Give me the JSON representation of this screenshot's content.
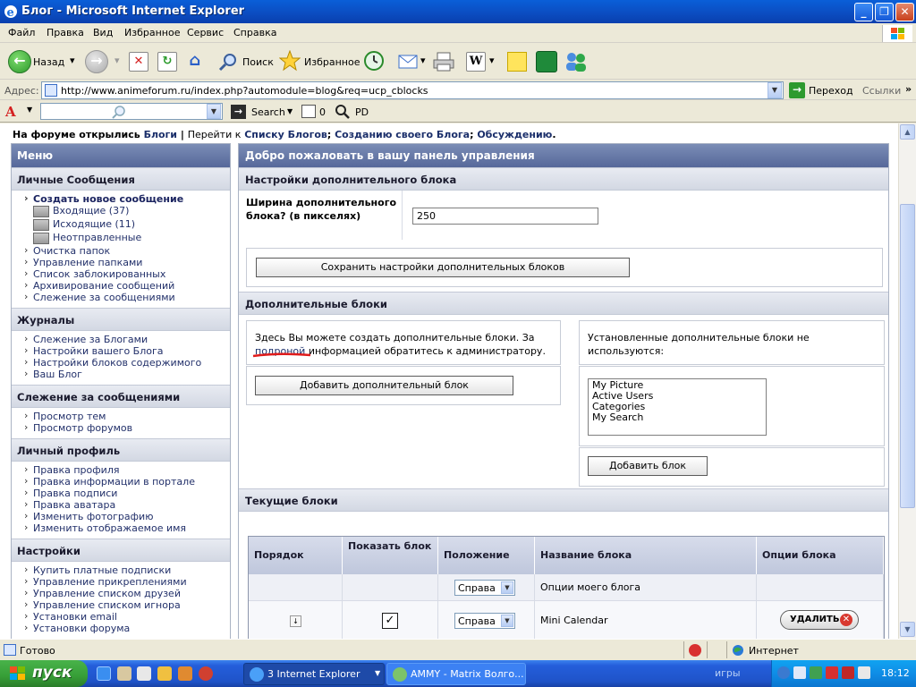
{
  "window": {
    "title": "Блог - Microsoft Internet Explorer",
    "min_glyph": "_",
    "max_glyph": "❐",
    "close_glyph": "✕"
  },
  "menubar": [
    "Файл",
    "Правка",
    "Вид",
    "Избранное",
    "Сервис",
    "Справка"
  ],
  "toolbar": {
    "back_label": "Назад",
    "search_label": "Поиск",
    "favorites_label": "Избранное",
    "icons": [
      "back-icon",
      "forward-icon",
      "stop-icon",
      "refresh-icon",
      "home-icon",
      "search-icon",
      "favorites-icon",
      "history-icon",
      "mail-icon",
      "print-icon",
      "edit-icon",
      "note-icon",
      "messenger-icon",
      "contacts-icon"
    ]
  },
  "address": {
    "label": "Адрес:",
    "url": "http://www.animeforum.ru/index.php?automodule=blog&req=ucp_cblocks",
    "go_label": "Переход",
    "links_label": "Ссылки",
    "more": "»"
  },
  "searchbar": {
    "search_label": "Search",
    "count": "0",
    "pd_label": "PD"
  },
  "content": {
    "info": {
      "part1": "На форуме открылись",
      "blogs_link": "Блоги",
      "sep": "|",
      "part2": "Перейти к",
      "list_link": "Списку Блогов",
      "create_link": "Созданию своего Блога",
      "discuss_link": "Обсуждению",
      "end": "."
    },
    "menu": {
      "title": "Меню",
      "sections": [
        {
          "title": "Личные Сообщения",
          "items": [
            "Создать новое сообщение",
            "Входящие (37)",
            "Исходящие (11)",
            "Неотправленные",
            "Очистка папок",
            "Управление папками",
            "Список заблокированных",
            "Архивирование сообщений",
            "Слежение за сообщениями"
          ]
        },
        {
          "title": "Журналы",
          "items": [
            "Слежение за Блогами",
            "Настройки вашего Блога",
            "Настройки блоков содержимого",
            "Ваш Блог"
          ]
        },
        {
          "title": "Слежение за сообщениями",
          "items": [
            "Просмотр тем",
            "Просмотр форумов"
          ]
        },
        {
          "title": "Личный профиль",
          "items": [
            "Правка профиля",
            "Правка информации в портале",
            "Правка подписи",
            "Правка аватара",
            "Изменить фотографию",
            "Изменить отображаемое имя"
          ]
        },
        {
          "title": "Настройки",
          "items": [
            "Купить платные подписки",
            "Управление прикреплениями",
            "Управление списком друзей",
            "Управление списком игнора",
            "Установки email",
            "Установки форума"
          ]
        }
      ]
    },
    "panel": {
      "title": "Добро пожаловать в вашу панель управления",
      "settings_header": "Настройки дополнительного блока",
      "width_label": "Ширина дополнительного блока? (в пикселях)",
      "width_value": "250",
      "save_button": "Сохранить настройки дополнительных блоков",
      "extra_header": "Дополнительные блоки",
      "extra_desc_1": "Здесь Вы можете создать дополнительные блоки. За",
      "extra_desc_link": "подроной",
      "extra_desc_2": "информацией обратитесь к администратору.",
      "add_extra_button": "Добавить дополнительный блок",
      "installed_desc": "Установленные дополнительные блоки не используются:",
      "installed_blocks": [
        "My Picture",
        "Active Users",
        "Categories",
        "My Search"
      ],
      "add_block_button": "Добавить блок",
      "current_header": "Текущие блоки",
      "table": {
        "headers": [
          "Порядок",
          "Показать блок",
          "Положение",
          "Название блока",
          "Опции блока"
        ],
        "rows": [
          {
            "position": "Справа",
            "name": "Опции моего блога",
            "checked": false
          },
          {
            "position": "Справа",
            "name": "Mini Calendar",
            "checked": true,
            "delete": "УДАЛИТЬ"
          }
        ]
      }
    }
  },
  "status": {
    "text": "Готово",
    "zone": "Интернет"
  },
  "taskbar": {
    "start": "пуск",
    "tasks": [
      "3 Internet Explorer",
      "AMMY - Matrix Волго..."
    ],
    "games": "игры",
    "clock": "18:12"
  },
  "colors": {
    "title_blue": "#0b4fc4",
    "panel_header": "#6a7ca8",
    "link_blue": "#1a2e6a",
    "annotation_red": "#e01b1b"
  }
}
